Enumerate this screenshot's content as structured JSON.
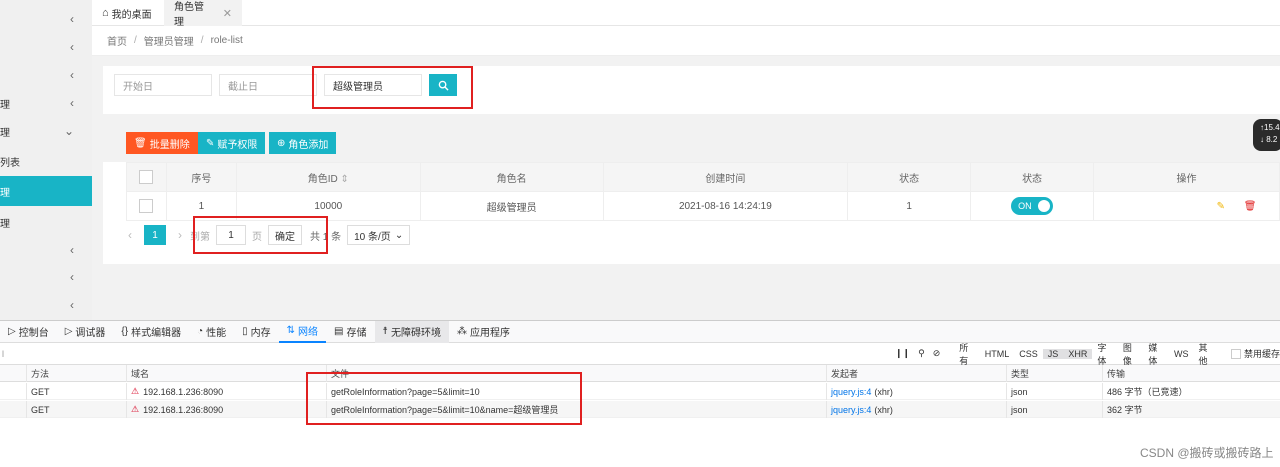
{
  "sidebar": {
    "items": [
      {
        "label": "",
        "chevron": "‹",
        "active": false
      },
      {
        "label": "",
        "chevron": "‹",
        "active": false
      },
      {
        "label": "",
        "chevron": "‹",
        "active": false
      },
      {
        "label": "理",
        "chevron": "‹",
        "active": false
      },
      {
        "label": "理",
        "chevron": "⌄",
        "active": false
      },
      {
        "label": "列表",
        "chevron": "",
        "active": false
      },
      {
        "label": "理",
        "chevron": "",
        "active": true
      },
      {
        "label": "理",
        "chevron": "",
        "active": false
      },
      {
        "label": "",
        "chevron": "‹",
        "active": false
      },
      {
        "label": "",
        "chevron": "‹",
        "active": false
      },
      {
        "label": "",
        "chevron": "‹",
        "active": false
      }
    ]
  },
  "tabs": {
    "home": "我的桌面",
    "role": "角色管理",
    "close": "✕"
  },
  "breadcrumb": [
    "首页",
    "管理员管理",
    "role-list"
  ],
  "filter": {
    "start_placeholder": "开始日",
    "end_placeholder": "截止日",
    "name_value": "超级管理员",
    "search_icon": "search-icon"
  },
  "toolbar": {
    "batch_delete": "批量删除",
    "assign_perm": "赋予权限",
    "add_role": "角色添加"
  },
  "table": {
    "headers": [
      "序号",
      "角色ID",
      "角色名",
      "创建时间",
      "状态",
      "状态",
      "操作"
    ],
    "rows": [
      {
        "index": "1",
        "role_id": "10000",
        "role_name": "超级管理员",
        "created": "2021-08-16 14:24:19",
        "status": "1",
        "switch": "ON"
      }
    ]
  },
  "pager": {
    "current": "1",
    "goto": "到第",
    "page_input": "1",
    "page_unit": "页",
    "confirm": "确定",
    "total_prefix": "共 1 条",
    "page_size": "10 条/页"
  },
  "right_widget": {
    "line1": "↑15.4",
    "line2": "↓ 8.2"
  },
  "devtools": {
    "tabs": [
      {
        "label": "控制台",
        "icon": "console-icon"
      },
      {
        "label": "调试器",
        "icon": "debugger-icon"
      },
      {
        "label": "样式编辑器",
        "icon": "style-editor-icon"
      },
      {
        "label": "性能",
        "icon": "performance-icon"
      },
      {
        "label": "内存",
        "icon": "memory-icon"
      },
      {
        "label": "网络",
        "icon": "network-icon"
      },
      {
        "label": "存储",
        "icon": "storage-icon"
      },
      {
        "label": "无障碍环境",
        "icon": "accessibility-icon"
      },
      {
        "label": "应用程序",
        "icon": "application-icon"
      }
    ],
    "filters": [
      "所有",
      "HTML",
      "CSS",
      "JS",
      "XHR",
      "字体",
      "图像",
      "媒体",
      "WS",
      "其他"
    ],
    "disable_cache": "禁用缓存",
    "columns": [
      "方法",
      "域名",
      "文件",
      "发起者",
      "类型",
      "传输"
    ],
    "requests": [
      {
        "method": "GET",
        "domain": "192.168.1.236:8090",
        "file": "getRoleInformation?page=5&limit=10",
        "initiator": "jquery.js:4",
        "initiator_suffix": "(xhr)",
        "type": "json",
        "transfer": "486 字节（已竞速）"
      },
      {
        "method": "GET",
        "domain": "192.168.1.236:8090",
        "file": "getRoleInformation?page=5&limit=10&name=超级管理员",
        "initiator": "jquery.js:4",
        "initiator_suffix": "(xhr)",
        "type": "json",
        "transfer": "362 字节"
      }
    ]
  },
  "watermark": "CSDN @搬砖或搬砖路上"
}
